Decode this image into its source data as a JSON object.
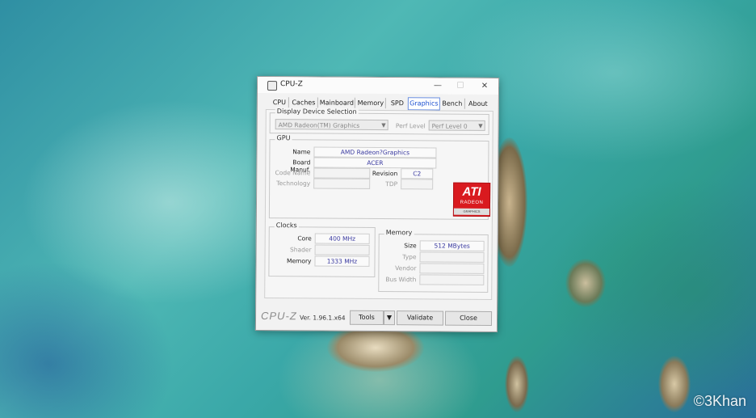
{
  "window": {
    "title": "CPU-Z",
    "controls": {
      "minimize": "—",
      "maximize": "☐",
      "close": "✕"
    }
  },
  "tabs": [
    {
      "label": "CPU"
    },
    {
      "label": "Caches"
    },
    {
      "label": "Mainboard"
    },
    {
      "label": "Memory"
    },
    {
      "label": "SPD"
    },
    {
      "label": "Graphics",
      "active": true
    },
    {
      "label": "Bench"
    },
    {
      "label": "About"
    }
  ],
  "display_selection": {
    "title": "Display Device Selection",
    "device": "AMD Radeon(TM) Graphics",
    "perf_label": "Perf Level",
    "perf_value": "Perf Level 0"
  },
  "gpu": {
    "title": "GPU",
    "name_label": "Name",
    "name_value": "AMD Radeon?Graphics",
    "board_label": "Board Manuf.",
    "board_value": "ACER",
    "code_label": "Code Name",
    "code_value": "",
    "revision_label": "Revision",
    "revision_value": "C2",
    "technology_label": "Technology",
    "technology_value": "",
    "tdp_label": "TDP",
    "tdp_value": "",
    "logo": {
      "line1": "ATI",
      "line2": "RADEON",
      "line3": "GRAPHICS",
      "color": "#d91a1f"
    }
  },
  "clocks": {
    "title": "Clocks",
    "core_label": "Core",
    "core_value": "400 MHz",
    "shader_label": "Shader",
    "shader_value": "",
    "memory_label": "Memory",
    "memory_value": "1333 MHz"
  },
  "memory": {
    "title": "Memory",
    "size_label": "Size",
    "size_value": "512 MBytes",
    "type_label": "Type",
    "type_value": "",
    "vendor_label": "Vendor",
    "vendor_value": "",
    "buswidth_label": "Bus Width",
    "buswidth_value": ""
  },
  "footer": {
    "brand": "CPU-Z",
    "version": "Ver. 1.96.1.x64",
    "tools_label": "Tools",
    "validate_label": "Validate",
    "close_label": "Close"
  },
  "watermark": "©3Khan"
}
